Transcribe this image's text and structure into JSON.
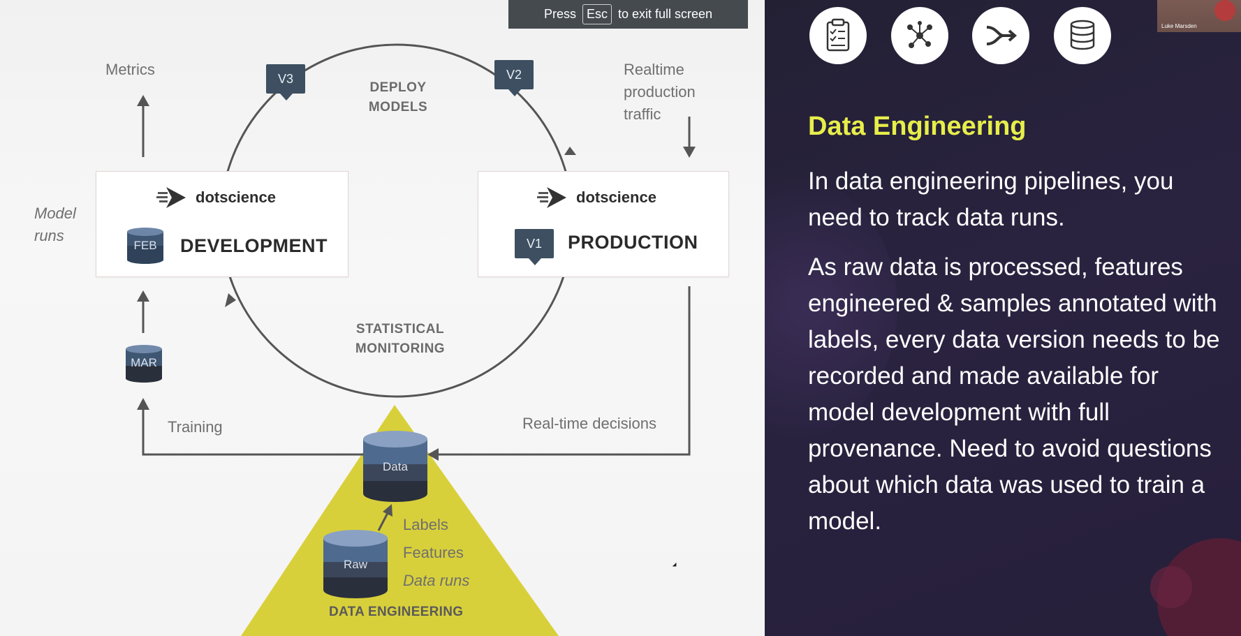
{
  "fullscreen_banner": {
    "press": "Press",
    "key": "Esc",
    "suffix": "to exit full screen"
  },
  "diagram": {
    "metrics": "Metrics",
    "model_runs": "Model\nruns",
    "deploy_models": "DEPLOY\nMODELS",
    "statistical_monitoring": "STATISTICAL\nMONITORING",
    "realtime_traffic": "Realtime\nproduction\ntraffic",
    "training": "Training",
    "realtime_decisions": "Real-time decisions",
    "development": {
      "brand": "dotscience",
      "title": "DEVELOPMENT",
      "badge": "FEB"
    },
    "production": {
      "brand": "dotscience",
      "title": "PRODUCTION",
      "badge": "V1"
    },
    "version_tags": {
      "v3": "V3",
      "v2": "V2"
    },
    "mar_badge": "MAR",
    "data_store": "Data",
    "raw_store": "Raw",
    "data_items": {
      "labels": "Labels",
      "features": "Features",
      "data_runs": "Data runs"
    },
    "data_engineering": "DATA ENGINEERING"
  },
  "slide": {
    "icons": [
      "clipboard-checklist-icon",
      "network-nodes-icon",
      "merge-arrows-icon",
      "database-icon"
    ],
    "title": "Data Engineering",
    "paragraph1": "In data engineering pipelines, you need to track data runs.",
    "paragraph2": "As raw data is processed, features engineered & samples annotated with labels, every data version needs to be recorded and made available for model development with full provenance. Need to avoid questions about which data was used to train a model.",
    "webcam_name": "Luke Marsden"
  },
  "colors": {
    "slide_bg": "#2a2340",
    "title_yellow": "#e7ee4a",
    "triangle_yellow": "#d8d03a",
    "tag_slate": "#3d4f61"
  }
}
